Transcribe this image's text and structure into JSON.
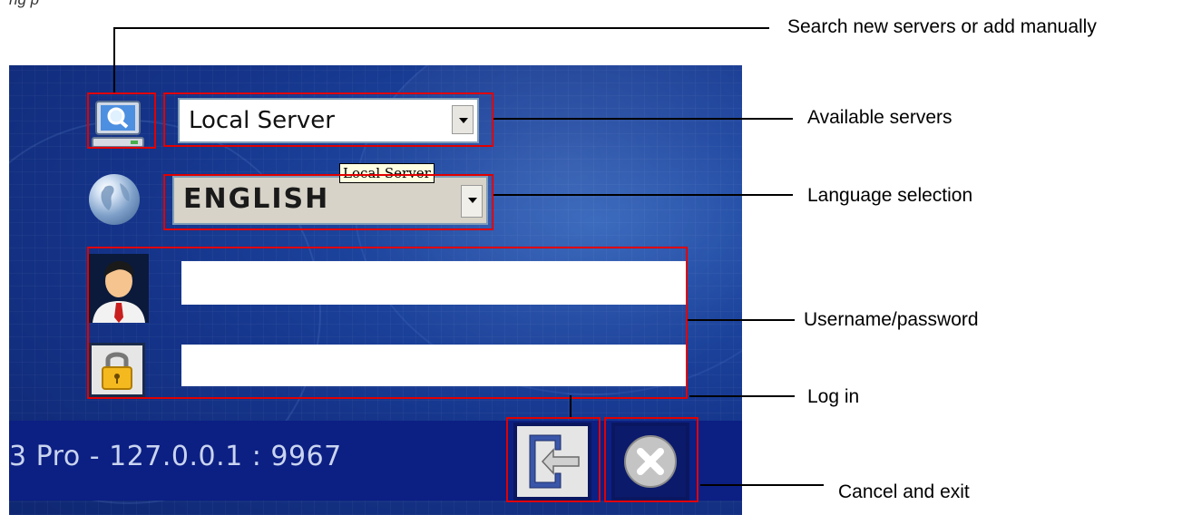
{
  "caption_fragment": "ng                    p",
  "server_select": {
    "value": "Local Server",
    "tooltip": "Local Server"
  },
  "language_select": {
    "value": "ENGLISH"
  },
  "login": {
    "username": "",
    "password": ""
  },
  "status_bar": {
    "text": "3 Pro - 127.0.0.1 : 9967"
  },
  "icons": {
    "server": "server-search-icon",
    "language": "globe-icon",
    "user": "user-avatar-icon",
    "password": "lock-icon",
    "login": "login-door-arrow-icon",
    "cancel": "cancel-x-icon"
  },
  "callouts": {
    "search": "Search new servers or add manually",
    "servers": "Available servers",
    "language": "Language selection",
    "credentials": "Username/password",
    "login": "Log in",
    "cancel": "Cancel and exit"
  },
  "colors": {
    "panel_bg": "#15348a",
    "status_bar_bg": "#0c1f83",
    "highlight": "#e10000"
  }
}
